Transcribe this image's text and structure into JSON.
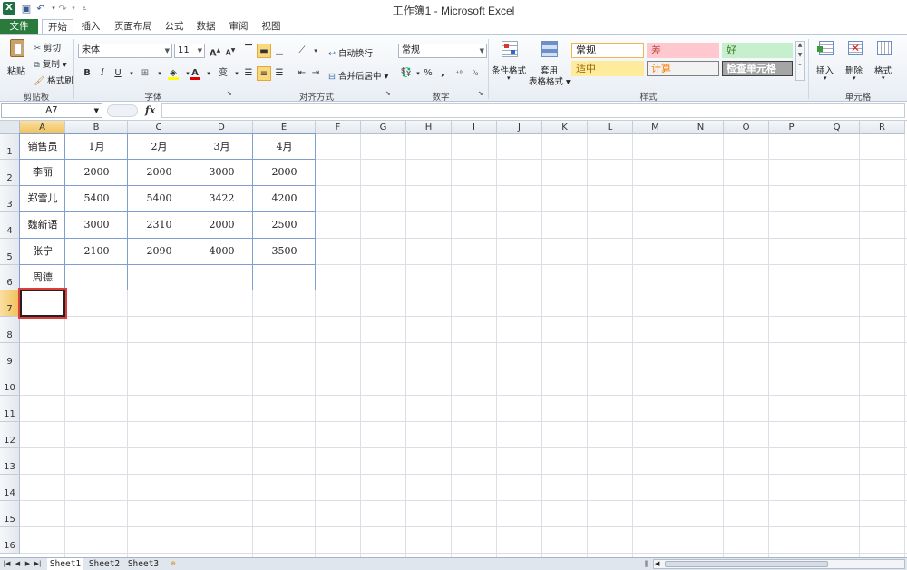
{
  "window": {
    "title": "工作簿1 - Microsoft Excel",
    "app_icon": "X"
  },
  "tabs": [
    {
      "label": "文件"
    },
    {
      "label": "开始"
    },
    {
      "label": "插入"
    },
    {
      "label": "页面布局"
    },
    {
      "label": "公式"
    },
    {
      "label": "数据"
    },
    {
      "label": "审阅"
    },
    {
      "label": "视图"
    }
  ],
  "ribbon": {
    "clipboard": {
      "paste": "粘贴",
      "cut": "剪切",
      "copy": "复制",
      "format_painter": "格式刷",
      "label": "剪贴板"
    },
    "font": {
      "name": "宋体",
      "size": "11",
      "label": "字体",
      "bold": "B",
      "italic": "I",
      "underline": "U",
      "grow": "A",
      "shrink": "A",
      "font_color": "A",
      "phonetic": "变"
    },
    "alignment": {
      "wrap": "自动换行",
      "merge": "合并后居中",
      "label": "对齐方式"
    },
    "number": {
      "format": "常规",
      "label": "数字",
      "percent": "%",
      "comma": ","
    },
    "styles": {
      "conditional": "条件格式",
      "table1": "套用",
      "table2": "表格格式",
      "label": "样式",
      "cells": [
        {
          "text": "常规",
          "bg": "#ffffff",
          "border": "#f0b74a",
          "color": "#222222"
        },
        {
          "text": "差",
          "bg": "#ffc7ce",
          "border": "#ffc7ce",
          "color": "#c0504d"
        },
        {
          "text": "好",
          "bg": "#c6efce",
          "border": "#c6efce",
          "color": "#38761d"
        },
        {
          "text": "适中",
          "bg": "#ffeb9c",
          "border": "#ffeb9c",
          "color": "#9c6500"
        },
        {
          "text": "计算",
          "bg": "#f2f2f2",
          "border": "#7f7f7f",
          "color": "#fa7d00"
        },
        {
          "text": "检查单元格",
          "bg": "#a5a5a5",
          "border": "#3f3f3f",
          "color": "#ffffff"
        }
      ]
    },
    "cells": {
      "insert": "插入",
      "delete": "删除",
      "format": "格式",
      "label": "单元格"
    }
  },
  "formula_bar": {
    "name_box": "A7",
    "fx": "fx",
    "value": ""
  },
  "grid": {
    "columns": [
      "A",
      "B",
      "C",
      "D",
      "E",
      "F",
      "G",
      "H",
      "I",
      "J",
      "K",
      "L",
      "M",
      "N",
      "O",
      "P",
      "Q",
      "R"
    ],
    "rows": [
      "1",
      "2",
      "3",
      "4",
      "5",
      "6",
      "7",
      "8",
      "9",
      "10",
      "11",
      "12",
      "13",
      "14",
      "15",
      "16"
    ],
    "selected_cell": "A7",
    "table": [
      [
        "销售员",
        "1月",
        "2月",
        "3月",
        "4月"
      ],
      [
        "李丽",
        "2000",
        "2000",
        "3000",
        "2000"
      ],
      [
        "郑雪儿",
        "5400",
        "5400",
        "3422",
        "4200"
      ],
      [
        "魏新语",
        "3000",
        "2310",
        "2000",
        "2500"
      ],
      [
        "张宁",
        "2100",
        "2090",
        "4000",
        "3500"
      ],
      [
        "周德",
        "",
        "",
        "",
        ""
      ]
    ]
  },
  "sheets": [
    {
      "label": "Sheet1",
      "active": true
    },
    {
      "label": "Sheet2",
      "active": false
    },
    {
      "label": "Sheet3",
      "active": false
    }
  ],
  "colors": {
    "accent": "#2a7a3b",
    "selection_border": "#e03c3c",
    "table_border": "#7e9dd1"
  }
}
